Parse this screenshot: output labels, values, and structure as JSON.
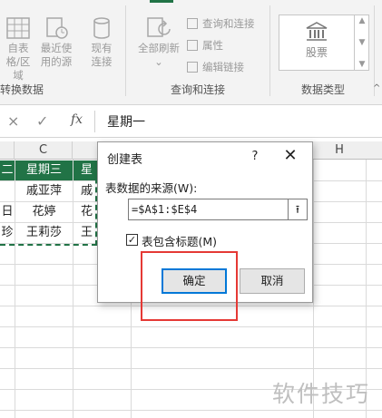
{
  "ribbon": {
    "buttons": {
      "from_table_line1": "自表",
      "from_table_line2": "格/区域",
      "recent_sources_line1": "最近使",
      "recent_sources_line2": "用的源",
      "existing_line1": "现有",
      "existing_line2": "连接",
      "refresh_line1": "全部刷新"
    },
    "small_commands": {
      "queries_connections": "查询和连接",
      "properties": "属性",
      "edit_links": "编辑链接"
    },
    "gallery": {
      "stocks": "股票"
    },
    "group_labels": {
      "get_transform": "转换数据",
      "queries": "查询和连接",
      "data_types": "数据类型"
    }
  },
  "formula_bar": {
    "cancel_glyph": "×",
    "enter_glyph": "✓",
    "fx_glyph": "fx",
    "value": "星期一"
  },
  "sheet": {
    "columns": [
      "C",
      "H"
    ],
    "rows": [
      [
        "二",
        "星期三",
        "星"
      ],
      [
        "",
        "戚亚萍",
        "戚"
      ],
      [
        "日",
        "花婷",
        "花"
      ],
      [
        "珍",
        "王莉莎",
        "王"
      ]
    ]
  },
  "dialog": {
    "title": "创建表",
    "help": "?",
    "close": "✕",
    "source_label": "表数据的来源(W):",
    "range_value": "=$A$1:$E$4",
    "collapse_glyph": "⭱",
    "has_headers_label": "表包含标题(M)",
    "has_headers_checked": "✓",
    "ok": "确定",
    "cancel": "取消"
  },
  "watermark": "软件技巧",
  "colors": {
    "accent": "#217346",
    "highlight": "#e53935",
    "focus": "#0078d7"
  }
}
